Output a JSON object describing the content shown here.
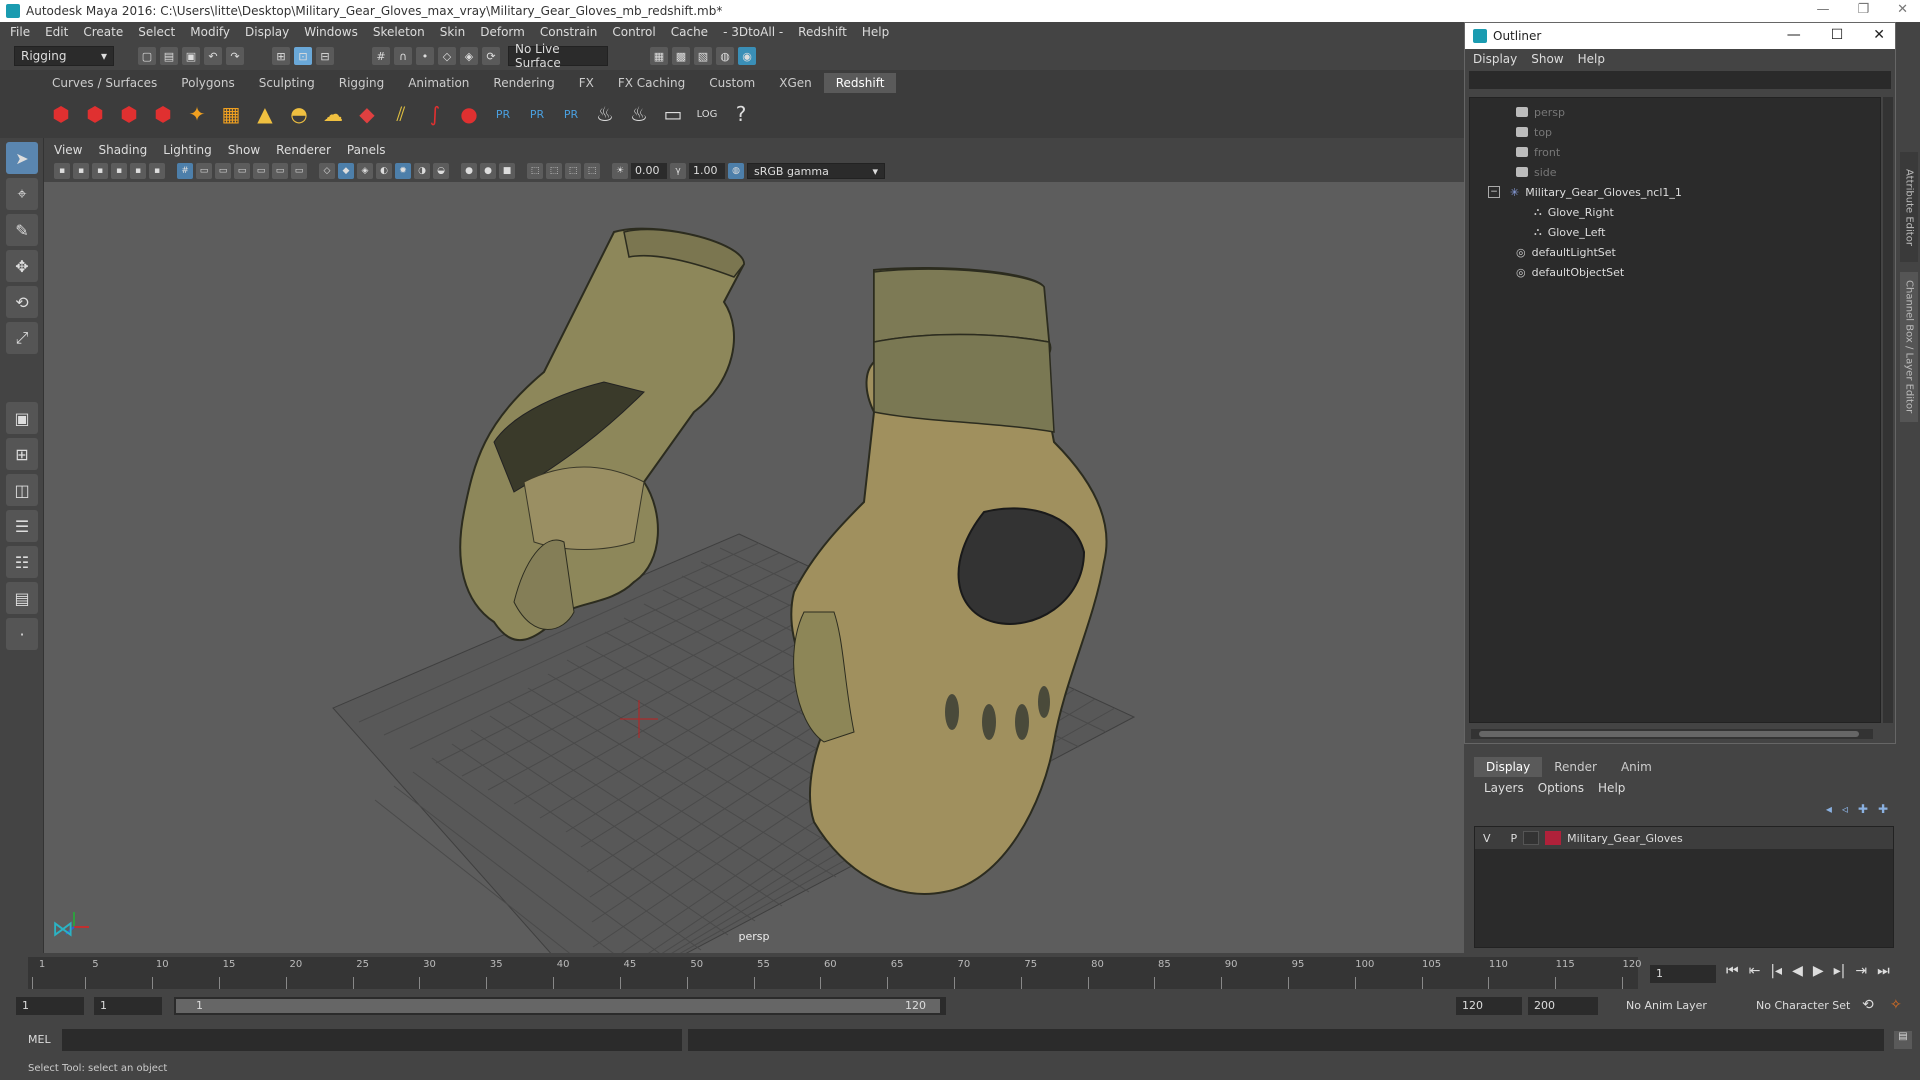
{
  "window": {
    "title": "Autodesk Maya 2016: C:\\Users\\litte\\Desktop\\Military_Gear_Gloves_max_vray\\Military_Gear_Gloves_mb_redshift.mb*"
  },
  "menubar": [
    "File",
    "Edit",
    "Create",
    "Select",
    "Modify",
    "Display",
    "Windows",
    "Skeleton",
    "Skin",
    "Deform",
    "Constrain",
    "Control",
    "Cache",
    "- 3DtoAll -",
    "Redshift",
    "Help"
  ],
  "toolbar": {
    "mode": "Rigging",
    "live_surface": "No Live Surface"
  },
  "shelf_tabs": [
    "Curves / Surfaces",
    "Polygons",
    "Sculpting",
    "Rigging",
    "Animation",
    "Rendering",
    "FX",
    "FX Caching",
    "Custom",
    "XGen",
    "Redshift"
  ],
  "shelf_active": "Redshift",
  "shelf_icons": [
    "RV",
    "IPR",
    "PR",
    "PR",
    "PR",
    "LOG",
    "?"
  ],
  "panel_menu": [
    "View",
    "Shading",
    "Lighting",
    "Show",
    "Renderer",
    "Panels"
  ],
  "panel_toolbar": {
    "exposure": "0.00",
    "gamma": "1.00",
    "colorspace": "sRGB gamma"
  },
  "viewport": {
    "camera": "persp"
  },
  "outliner": {
    "title": "Outliner",
    "menu": [
      "Display",
      "Show",
      "Help"
    ],
    "items": [
      {
        "label": "persp",
        "type": "camera",
        "dim": true
      },
      {
        "label": "top",
        "type": "camera",
        "dim": true
      },
      {
        "label": "front",
        "type": "camera",
        "dim": true
      },
      {
        "label": "side",
        "type": "camera",
        "dim": true
      },
      {
        "label": "Military_Gear_Gloves_ncl1_1",
        "type": "group",
        "dim": false
      },
      {
        "label": "Glove_Right",
        "type": "mesh",
        "dim": false
      },
      {
        "label": "Glove_Left",
        "type": "mesh",
        "dim": false
      },
      {
        "label": "defaultLightSet",
        "type": "set",
        "dim": false
      },
      {
        "label": "defaultObjectSet",
        "type": "set",
        "dim": false
      }
    ]
  },
  "side_tabs": [
    "Attribute Editor",
    "Channel Box / Layer Editor"
  ],
  "layer_editor": {
    "tabs": [
      "Display",
      "Render",
      "Anim"
    ],
    "active_tab": "Display",
    "menu": [
      "Layers",
      "Options",
      "Help"
    ],
    "layer": {
      "v": "V",
      "p": "P",
      "name": "Military_Gear_Gloves",
      "color": "#b0213a"
    }
  },
  "timeline": {
    "ticks": [
      "1",
      "5",
      "10",
      "15",
      "20",
      "25",
      "30",
      "35",
      "40",
      "45",
      "50",
      "55",
      "60",
      "65",
      "70",
      "75",
      "80",
      "85",
      "90",
      "95",
      "100",
      "105",
      "110",
      "115",
      "120"
    ],
    "current_frame": "1"
  },
  "range": {
    "start": "1",
    "playback_start": "1",
    "slider_start": "1",
    "slider_end": "120",
    "playback_end": "120",
    "end": "200",
    "anim_layer": "No Anim Layer",
    "char_set": "No Character Set"
  },
  "command": {
    "lang": "MEL"
  },
  "status": "Select Tool: select an object"
}
